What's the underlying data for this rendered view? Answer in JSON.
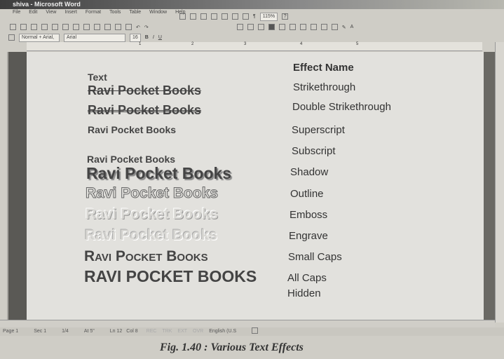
{
  "window": {
    "title": "shiva - Microsoft Word"
  },
  "menu": [
    "File",
    "Edit",
    "View",
    "Insert",
    "Format",
    "Tools",
    "Table",
    "Window",
    "Help"
  ],
  "toolbar": {
    "zoom": "115%",
    "style": "Normal + Arial,",
    "font": "Arial",
    "size": "16",
    "bold": "B",
    "italic": "I",
    "underline": "U"
  },
  "ruler": {
    "marks": [
      "1",
      "2",
      "3",
      "4",
      "5"
    ]
  },
  "document": {
    "header_text": "Text",
    "header_effect": "Effect Name",
    "rows": [
      {
        "text": "Ravi Pocket Books",
        "effect": "Strikethrough"
      },
      {
        "text": "Ravi Pocket Books",
        "effect": "Double Strikethrough"
      },
      {
        "text": "Ravi Pocket Books",
        "effect": "Superscript"
      },
      {
        "text": "Ravi Pocket Books",
        "effect": "Subscript"
      },
      {
        "text": "Ravi Pocket Books",
        "effect": "Shadow"
      },
      {
        "text": "Ravi Pocket Books",
        "effect": "Outline"
      },
      {
        "text": "Ravi Pocket Books",
        "effect": "Emboss"
      },
      {
        "text": "Ravi Pocket Books",
        "effect": "Engrave"
      },
      {
        "text": "Ravi Pocket Books",
        "effect": "Small Caps"
      },
      {
        "text": "Ravi Pocket Books",
        "effect": "All Caps"
      },
      {
        "text": "",
        "effect": "Hidden"
      }
    ]
  },
  "status": {
    "page": "Page 1",
    "sec": "Sec 1",
    "pages": "1/4",
    "at": "At 5\"",
    "ln": "Ln 12",
    "col": "Col 8",
    "rec": "REC",
    "trk": "TRK",
    "ext": "EXT",
    "ovr": "OVR",
    "lang": "English (U.S"
  },
  "caption": "Fig. 1.40 : Various Text Effects"
}
